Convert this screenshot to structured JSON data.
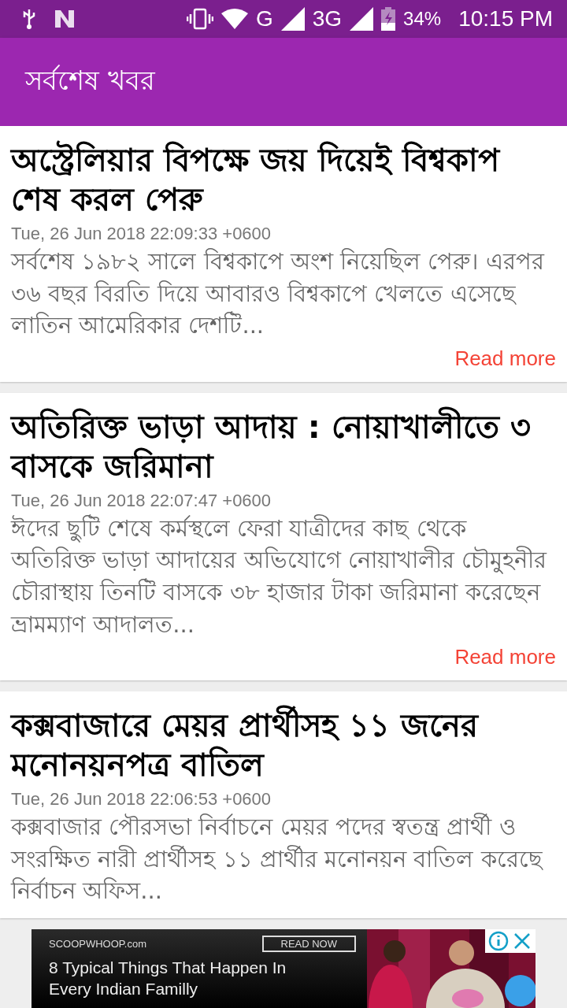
{
  "status_bar": {
    "network_1": "G",
    "network_2": "3G",
    "battery": "34%",
    "time": "10:15 PM"
  },
  "app_bar": {
    "title": "সর্বশেষ খবর"
  },
  "articles": [
    {
      "title": "অস্ট্রেলিয়ার বিপক্ষে জয় দিয়েই বিশ্বকাপ শেষ করল পেরু",
      "date": "Tue, 26 Jun 2018 22:09:33 +0600",
      "summary": "সর্বশেষ ১৯৮২ সালে বিশ্বকাপে অংশ নিয়েছিল পেরু। এরপর ৩৬ বছর বিরতি দিয়ে আবারও বিশ্বকাপে খেলতে এসেছে লাতিন আমেরিকার দেশটি...",
      "link": "Read more"
    },
    {
      "title": "অতিরিক্ত ভাড়া আদায় : নোয়াখালীতে ৩ বাসকে জরিমানা",
      "date": "Tue, 26 Jun 2018 22:07:47 +0600",
      "summary": "ঈদের ছুটি শেষে কর্মস্থলে ফেরা যাত্রীদের কাছ থেকে অতিরিক্ত ভাড়া আদায়ের অভিযোগে নোয়াখালীর চৌমুহনীর চৌরাস্থায় তিনটি বাসকে ৩৮ হাজার টাকা জরিমানা করেছেন ভ্রামম্যাণ আদালত...",
      "link": "Read more"
    },
    {
      "title": "কক্সবাজারে মেয়র প্রার্থীসহ ১১ জনের মনোনয়নপত্র বাতিল",
      "date": "Tue, 26 Jun 2018 22:06:53 +0600",
      "summary": "কক্সবাজার পৌরসভা নির্বাচনে মেয়র পদের স্বতন্ত্র প্রার্থী ও সংরক্ষিত নারী প্রার্থীসহ ১১ প্রার্থীর মনোনয়ন বাতিল করেছে নির্বাচন অফিস..."
    }
  ],
  "ad": {
    "brand": "SCOOPWHOOP.com",
    "button": "READ NOW",
    "headline": "8 Typical Things That Happen In Every Indian Familly"
  }
}
